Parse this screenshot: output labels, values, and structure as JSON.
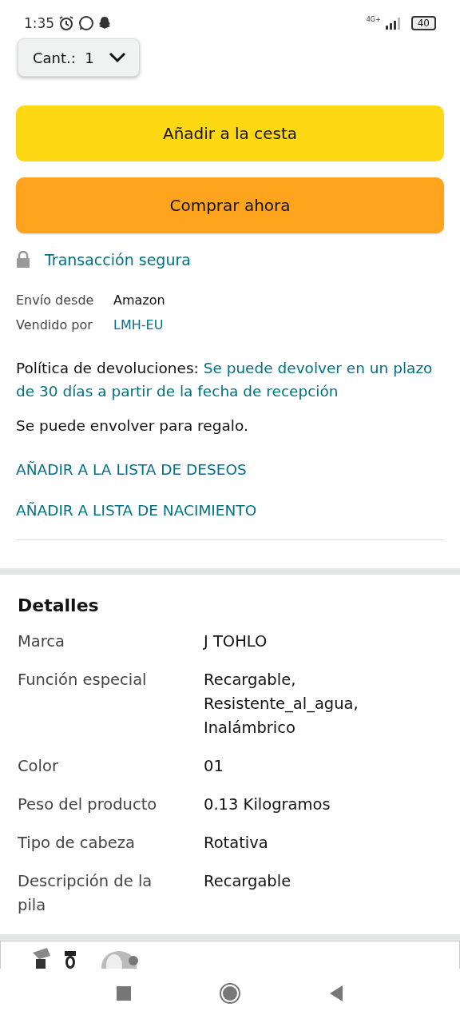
{
  "status_bar": {
    "time": "1:35",
    "network": "4G+",
    "battery": "40"
  },
  "quantity": {
    "label": "Cant.:",
    "value": "1"
  },
  "buttons": [
    {
      "label": "Añadir a la cesta",
      "kind": "cart"
    },
    {
      "label": "Comprar ahora",
      "kind": "buy"
    }
  ],
  "secure": "Transacción segura",
  "seller_info": [
    {
      "label": "Envío desde",
      "value": "Amazon",
      "link": false
    },
    {
      "label": "Vendido por",
      "value": "LMH-EU",
      "link": true
    }
  ],
  "returns": {
    "label": "Política de devoluciones:",
    "link": "Se puede devolver en un plazo de 30 días a partir de la fecha de recepción"
  },
  "gift": "Se puede envolver para regalo.",
  "links": [
    "AÑADIR A LA LISTA DE DESEOS",
    "AÑADIR A LISTA DE NACIMIENTO"
  ],
  "details": {
    "title": "Detalles",
    "rows": [
      {
        "label": "Marca",
        "value": "J TOHLO"
      },
      {
        "label": "Función especial",
        "value": "Recargable,\nResistente_al_agua,\nInalámbrico"
      },
      {
        "label": "Color",
        "value": "01"
      },
      {
        "label": "Peso del producto",
        "value": "0.13 Kilogramos"
      },
      {
        "label": "Tipo de cabeza",
        "value": "Rotativa"
      },
      {
        "label": "Descripción de la pila",
        "value": "Recargable"
      }
    ]
  }
}
